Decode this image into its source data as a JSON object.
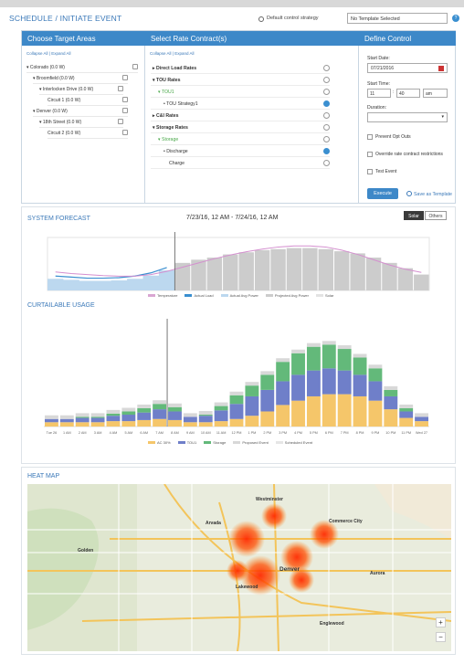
{
  "header": {
    "title": "SCHEDULE / INITIATE EVENT",
    "default_strategy_label": "Default control strategy",
    "template_select": "No Template Selected",
    "help_icon": "?"
  },
  "target_areas": {
    "heading": "Choose Target Areas",
    "collapse_all": "Collapse All",
    "separator": "|",
    "expand_all": "Expand All",
    "items": [
      {
        "label": "▾ Colorado (0.0 W)"
      },
      {
        "label": "▾ Broomfield (0.0 W)"
      },
      {
        "label": "▾ Interlocken Drive (0.0 W)"
      },
      {
        "label": "Circuit 1 (0.0 W)"
      },
      {
        "label": "▾ Denver (0.0 W)"
      },
      {
        "label": "▾ 18th Street (0.0 W)"
      },
      {
        "label": "Circuit 2 (0.0 W)"
      }
    ]
  },
  "rate_contracts": {
    "heading": "Select Rate Contract(s)",
    "collapse_all": "Collapse All",
    "separator": "|",
    "expand_all": "Expand All",
    "items": [
      {
        "label": "▸ Direct Load Rates"
      },
      {
        "label": "▾ TOU Rates"
      },
      {
        "label": "▾ TOU1"
      },
      {
        "label": "• TOU Strategy1"
      },
      {
        "label": "▸ C&I Rates"
      },
      {
        "label": "▾ Storage Rates"
      },
      {
        "label": "▾ Storage"
      },
      {
        "label": "• Discharge"
      },
      {
        "label": "Charge"
      }
    ]
  },
  "define_control": {
    "heading": "Define Control",
    "start_date_label": "Start Date:",
    "start_date": "07/21/2016",
    "start_time_label": "Start Time:",
    "hour": "11",
    "minute": "40",
    "ampm": "am",
    "duration_label": "Duration:",
    "duration": "",
    "prevent_opt_outs": "Prevent Opt Outs",
    "override": "Override rate contract restrictions",
    "test_event": "Test Event",
    "execute": "Execute",
    "save_template": "Save as Template"
  },
  "forecast": {
    "title": "SYSTEM FORECAST",
    "date_from": "7/23/16, 12 AM",
    "dash": "-",
    "date_to": "7/24/16, 12 AM",
    "toggle_a": "Solar",
    "toggle_b": "Others",
    "legend": [
      "Temperature",
      "Actual Load",
      "Actual Avg Power",
      "Projected Avg Power",
      "Solar"
    ]
  },
  "curtailable": {
    "title": "CURTAILABLE USAGE",
    "legend": [
      "AC 30%",
      "TOU1",
      "Storage",
      "Proposed Event",
      "Scheduled Event"
    ]
  },
  "heatmap": {
    "title": "HEAT MAP",
    "zoom_in": "+",
    "zoom_out": "−",
    "places": [
      "Westminster",
      "Arvada",
      "Denver",
      "Lakewood",
      "Aurora",
      "Golden",
      "Commerce City",
      "Englewood"
    ]
  },
  "colors": {
    "accent": "#3d88c8",
    "ac": "#f5c66a",
    "tou": "#6f7fc9",
    "storage": "#63b97a",
    "proposed": "#d8d8d8",
    "actual": "#bcd8ef",
    "projected": "#cccccc"
  },
  "chart_data": [
    {
      "type": "area",
      "title": "SYSTEM FORECAST",
      "series": [
        {
          "name": "Actual Avg Power",
          "values": [
            22,
            20,
            18,
            18,
            19,
            22,
            28,
            38,
            0,
            0,
            0,
            0,
            0,
            0,
            0,
            0,
            0,
            0,
            0,
            0,
            0,
            0,
            0,
            0
          ]
        },
        {
          "name": "Projected Avg Power",
          "values": [
            0,
            0,
            0,
            0,
            0,
            0,
            0,
            0,
            52,
            58,
            62,
            68,
            72,
            76,
            78,
            80,
            80,
            78,
            74,
            70,
            62,
            52,
            42,
            30
          ]
        },
        {
          "name": "Temperature",
          "values": [
            35,
            32,
            30,
            28,
            27,
            27,
            30,
            36,
            44,
            52,
            60,
            67,
            73,
            78,
            82,
            84,
            84,
            82,
            76,
            68,
            58,
            48,
            40,
            34
          ]
        }
      ]
    },
    {
      "type": "bar",
      "title": "CURTAILABLE USAGE",
      "categories": [
        "Tue 26",
        "1 AM",
        "2 AM",
        "3 AM",
        "4 AM",
        "5 AM",
        "6 AM",
        "7 AM",
        "8 AM",
        "9 AM",
        "10 AM",
        "11 AM",
        "12 PM",
        "1 PM",
        "2 PM",
        "3 PM",
        "4 PM",
        "5 PM",
        "6 PM",
        "7 PM",
        "8 PM",
        "9 PM",
        "10 PM",
        "11 PM",
        "Wed 27"
      ],
      "ylim": [
        0,
        100
      ],
      "series": [
        {
          "name": "AC 30%",
          "values": [
            4,
            4,
            4,
            4,
            5,
            5,
            6,
            7,
            6,
            4,
            4,
            5,
            7,
            10,
            14,
            20,
            24,
            28,
            30,
            30,
            28,
            24,
            16,
            8,
            5
          ]
        },
        {
          "name": "TOU1",
          "values": [
            3,
            3,
            4,
            4,
            5,
            6,
            7,
            9,
            8,
            5,
            6,
            10,
            14,
            18,
            20,
            22,
            24,
            24,
            24,
            22,
            20,
            18,
            12,
            6,
            4
          ]
        },
        {
          "name": "Storage",
          "values": [
            0,
            0,
            1,
            1,
            2,
            3,
            4,
            5,
            4,
            0,
            1,
            4,
            8,
            10,
            14,
            18,
            20,
            22,
            22,
            20,
            16,
            12,
            6,
            3,
            0
          ]
        }
      ]
    }
  ]
}
